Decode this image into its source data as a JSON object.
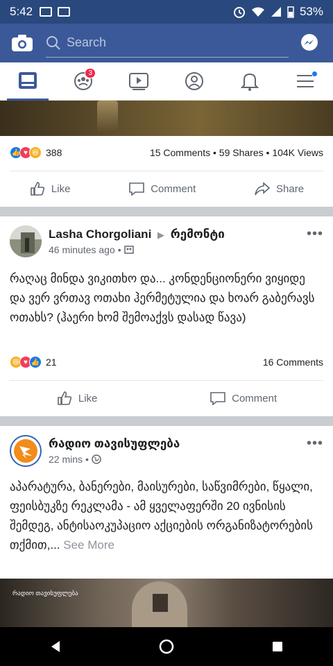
{
  "status_bar": {
    "time": "5:42",
    "battery": "53%"
  },
  "search": {
    "placeholder": "Search"
  },
  "nav": {
    "groups_badge": "3"
  },
  "post_prev": {
    "reaction_count": "388",
    "comments": "15 Comments",
    "shares": "59 Shares",
    "views": "104K Views",
    "like_label": "Like",
    "comment_label": "Comment",
    "share_label": "Share"
  },
  "post1": {
    "author": "Lasha Chorgoliani",
    "arrow": "▶",
    "group": "რემონტი",
    "time": "46 minutes ago",
    "text": "რაღაც მინდა ვიკითხო და... კონდენციონერი ვიყიდე და ვერ ვრთავ ოთახი ჰერმეტულია და ხოარ გაბერავს ოთახს? (ჰაერი ხომ შემოაქვს დასად წავა)",
    "reaction_count": "21",
    "comments": "16 Comments",
    "like_label": "Like",
    "comment_label": "Comment",
    "more": "•••"
  },
  "post2": {
    "author": "რადიო თავისუფლება",
    "time": "22 mins",
    "text": "აპარატურა, ბანერები, მაისურები, საწვიმრები, წყალი, ფეისბუკზე რეკლამა - ამ ყველაფერში 20 ივნისის შემდეგ, ანტისაოკუპაციო აქციების ორგანიზატორების თქმით,...",
    "see_more": "See More",
    "more": "•••",
    "image_logo": "რადიო თავისუფლება"
  },
  "colors": {
    "brand": "#3b5998",
    "status": "#29487d",
    "like": "#1877f2",
    "love": "#f33e58",
    "haha": "#f7b125",
    "badge": "#f02849"
  }
}
